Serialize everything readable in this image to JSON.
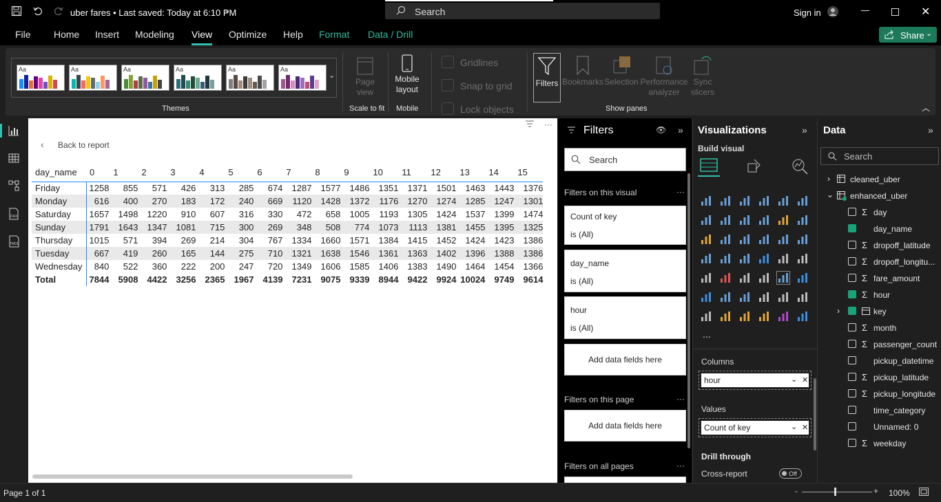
{
  "titlebar": {
    "file_title": "uber fares • Last saved: Today at 6:10 PM",
    "search_label": "Search",
    "sign_in": "Sign in"
  },
  "menu": {
    "items": [
      "File",
      "Home",
      "Insert",
      "Modeling",
      "View",
      "Optimize",
      "Help",
      "Format",
      "Data / Drill"
    ],
    "active": "View",
    "share_label": "Share"
  },
  "ribbon": {
    "themes_label": "Themes",
    "page_view_label": "Page view",
    "scale_to_fit_label": "Scale to fit",
    "mobile_layout_label": "Mobile layout",
    "mobile_label": "Mobile",
    "gridlines_label": "Gridlines",
    "snap_label": "Snap to grid",
    "lock_label": "Lock objects",
    "filters_label": "Filters",
    "bookmarks_label": "Bookmarks",
    "selection_label": "Selection",
    "performance_label": "Performance analyzer",
    "sync_label": "Sync slicers",
    "show_panes_label": "Show panes"
  },
  "canvas": {
    "back_label": "Back to report",
    "matrix": {
      "corner_header": "day_name",
      "columns": [
        "0",
        "1",
        "2",
        "3",
        "4",
        "5",
        "6",
        "7",
        "8",
        "9",
        "10",
        "11",
        "12",
        "13",
        "14",
        "15"
      ],
      "rows": [
        {
          "label": "Friday",
          "values": [
            "1258",
            "855",
            "571",
            "426",
            "313",
            "285",
            "674",
            "1287",
            "1577",
            "1486",
            "1351",
            "1371",
            "1501",
            "1463",
            "1443",
            "1376"
          ]
        },
        {
          "label": "Monday",
          "values": [
            "616",
            "400",
            "270",
            "183",
            "172",
            "240",
            "669",
            "1120",
            "1428",
            "1372",
            "1176",
            "1270",
            "1274",
            "1285",
            "1247",
            "1301"
          ]
        },
        {
          "label": "Saturday",
          "values": [
            "1657",
            "1498",
            "1220",
            "910",
            "607",
            "316",
            "330",
            "472",
            "658",
            "1005",
            "1193",
            "1305",
            "1424",
            "1537",
            "1399",
            "1474"
          ]
        },
        {
          "label": "Sunday",
          "values": [
            "1791",
            "1643",
            "1347",
            "1081",
            "715",
            "300",
            "269",
            "348",
            "508",
            "774",
            "1073",
            "1113",
            "1381",
            "1455",
            "1395",
            "1325"
          ]
        },
        {
          "label": "Thursday",
          "values": [
            "1015",
            "571",
            "394",
            "269",
            "214",
            "304",
            "767",
            "1334",
            "1660",
            "1571",
            "1384",
            "1415",
            "1452",
            "1424",
            "1423",
            "1386"
          ]
        },
        {
          "label": "Tuesday",
          "values": [
            "667",
            "419",
            "260",
            "165",
            "144",
            "275",
            "710",
            "1321",
            "1638",
            "1546",
            "1361",
            "1363",
            "1402",
            "1396",
            "1388",
            "1386"
          ]
        },
        {
          "label": "Wednesday",
          "values": [
            "840",
            "522",
            "360",
            "222",
            "200",
            "247",
            "720",
            "1349",
            "1606",
            "1585",
            "1406",
            "1383",
            "1490",
            "1464",
            "1454",
            "1366"
          ]
        }
      ],
      "total": {
        "label": "Total",
        "values": [
          "7844",
          "5908",
          "4422",
          "3256",
          "2365",
          "1967",
          "4139",
          "7231",
          "9075",
          "9339",
          "8944",
          "9422",
          "9924",
          "10024",
          "9749",
          "9614"
        ]
      }
    }
  },
  "filters": {
    "title": "Filters",
    "search_placeholder": "Search",
    "on_visual_label": "Filters on this visual",
    "cards": [
      {
        "name": "Count of key",
        "state": "is (All)"
      },
      {
        "name": "day_name",
        "state": "is (All)"
      },
      {
        "name": "hour",
        "state": "is (All)"
      }
    ],
    "add_fields_label": "Add data fields here",
    "on_page_label": "Filters on this page",
    "on_all_pages_label": "Filters on all pages"
  },
  "visualizations": {
    "title": "Visualizations",
    "build_visual_label": "Build visual",
    "columns_label": "Columns",
    "columns_value": "hour",
    "values_label": "Values",
    "values_value": "Count of key",
    "drill_through_label": "Drill through",
    "cross_report_label": "Cross-report",
    "toggle_state": "Off",
    "more": "..."
  },
  "data": {
    "title": "Data",
    "search_placeholder": "Search",
    "tables": [
      {
        "name": "cleaned_uber",
        "expanded": false
      },
      {
        "name": "enhanced_uber",
        "expanded": true
      }
    ],
    "fields": [
      {
        "name": "day",
        "sigma": true,
        "checked": false
      },
      {
        "name": "day_name",
        "sigma": false,
        "checked": true
      },
      {
        "name": "dropoff_latitude",
        "sigma": true,
        "checked": false
      },
      {
        "name": "dropoff_longitu...",
        "sigma": true,
        "checked": false
      },
      {
        "name": "fare_amount",
        "sigma": true,
        "checked": false
      },
      {
        "name": "hour",
        "sigma": true,
        "checked": true
      },
      {
        "name": "key",
        "sigma": false,
        "checked": true
      },
      {
        "name": "month",
        "sigma": true,
        "checked": false
      },
      {
        "name": "passenger_count",
        "sigma": true,
        "checked": false
      },
      {
        "name": "pickup_datetime",
        "sigma": false,
        "checked": false
      },
      {
        "name": "pickup_latitude",
        "sigma": true,
        "checked": false
      },
      {
        "name": "pickup_longitude",
        "sigma": true,
        "checked": false
      },
      {
        "name": "time_category",
        "sigma": false,
        "checked": false
      },
      {
        "name": "Unnamed: 0",
        "sigma": false,
        "checked": false
      },
      {
        "name": "weekday",
        "sigma": true,
        "checked": false
      }
    ]
  },
  "status": {
    "page_label": "Page 1 of 1",
    "zoom": "100%"
  }
}
